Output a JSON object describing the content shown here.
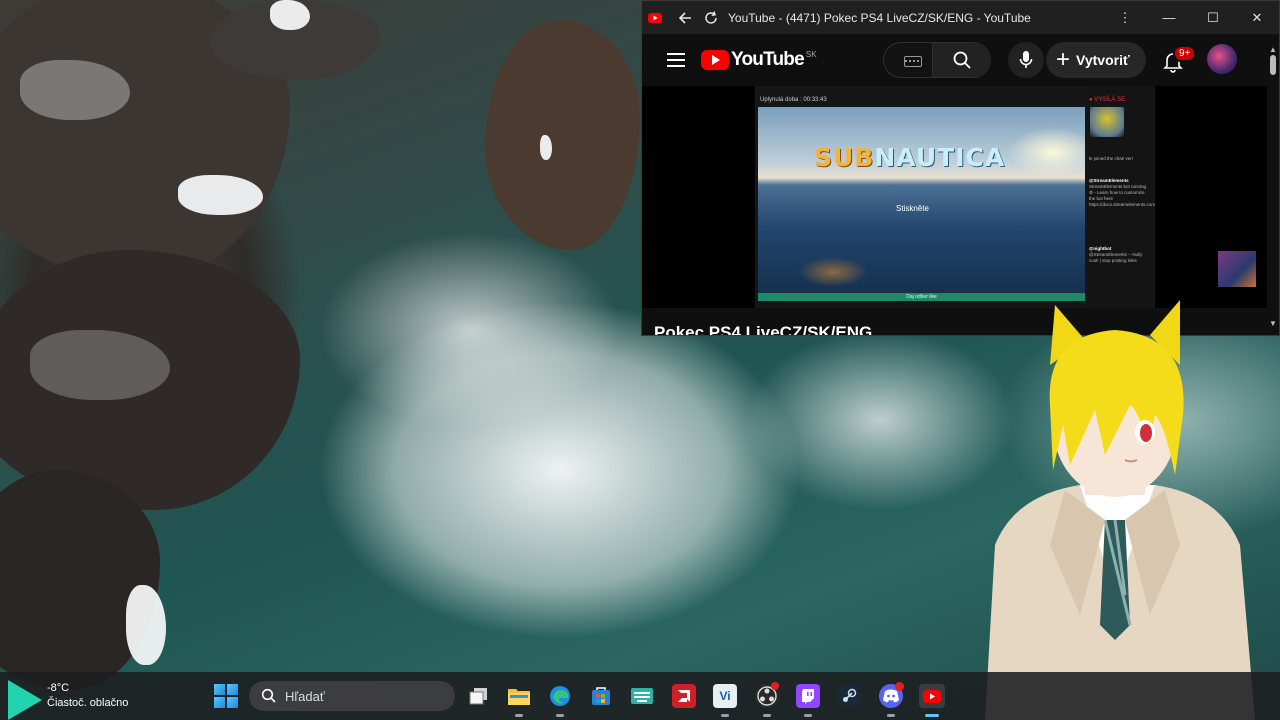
{
  "window": {
    "title": "YouTube - (4471) Pokec PS4 LiveCZ/SK/ENG - YouTube",
    "controls": {
      "minimize": "—",
      "maximize": "☐",
      "close": "✕"
    }
  },
  "youtube": {
    "logo_text": "YouTube",
    "region": "SK",
    "create_label": "Vytvoriť",
    "notifications_badge": "9+",
    "video_title": "Pokec PS4 LiveCZ/SK/ENG"
  },
  "stream": {
    "elapsed": "Uplynulá doba : 00:33:43",
    "game_title_part1": "SUB",
    "game_title_part2": "NAUTICA",
    "prompt": "Stiskněte",
    "follow_bar": "Daj odber like",
    "live_label": "● VYSÍLÁ SE",
    "chat_joined": "le joined the chat! ver!",
    "chat": [
      {
        "user": "@StreamElements",
        "text": "StreamElements bot running ⚙ - Learn how to customize the bot here https://docs.streamelements.com"
      },
      {
        "user": "@nightbot",
        "text": "@StreamElements -- Nolly cool! | stop posting links"
      }
    ]
  },
  "taskbar": {
    "temperature": "-8°C",
    "condition": "Čiastoč. oblačno",
    "search_placeholder": "Hľadať"
  },
  "colors": {
    "youtube_red": "#ff0000",
    "notification_red": "#cc0000",
    "follow_bar_green": "#1e8a68",
    "accent_teal": "#22d3b0"
  }
}
